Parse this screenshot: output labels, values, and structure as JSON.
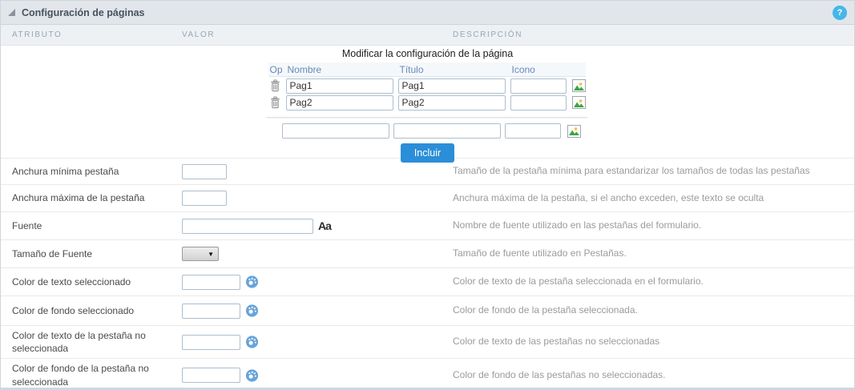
{
  "panel": {
    "title": "Configuración de páginas"
  },
  "help": {
    "label": "?"
  },
  "columns": {
    "attribute": "Atributo",
    "value": "Valor",
    "description": "Descripción"
  },
  "page_editor": {
    "title": "Modificar la configuración de la página",
    "headers": {
      "op": "Op",
      "name": "Nombre",
      "page_title": "Título",
      "icon": "Icono"
    },
    "rows": [
      {
        "name": "Pag1",
        "page_title": "Pag1",
        "icon": ""
      },
      {
        "name": "Pag2",
        "page_title": "Pag2",
        "icon": ""
      }
    ],
    "new_row": {
      "name": "",
      "page_title": "",
      "icon": ""
    },
    "include_button": "Incluir"
  },
  "attributes": [
    {
      "label": "Anchura mínima pestaña",
      "value": "",
      "description": "Tamaño de la pestaña mínima para estandarizar los tamaños de todas las pestañas"
    },
    {
      "label": "Anchura máxima de la pestaña",
      "value": "",
      "description": "Anchura máxima de la pestaña, si el ancho exceden, este texto se oculta"
    },
    {
      "label": "Fuente",
      "value": "",
      "description": "Nombre de fuente utilizado en las pestañas del formulario.",
      "icon_label": "Aa"
    },
    {
      "label": "Tamaño de Fuente",
      "value": "",
      "description": "Tamaño de fuente utilizado en Pestañas."
    },
    {
      "label": "Color de texto seleccionado",
      "value": "",
      "description": "Color de texto de la pestaña seleccionada en el formulario."
    },
    {
      "label": "Color de fondo seleccionado",
      "value": "",
      "description": "Color de fondo de la pestaña seleccionada."
    },
    {
      "label": "Color de texto de la pestaña no seleccionada",
      "value": "",
      "description": "Color de texto de las pestañas no seleccionadas"
    },
    {
      "label": "Color de fondo de la pestaña no seleccionada",
      "value": "",
      "description": "Color de fondo de las pestañas no seleccionadas."
    }
  ],
  "colors": {
    "accent_blue": "#2b8ed8",
    "help_blue": "#45b7e8",
    "header_bg": "#e2e6ea",
    "colhead_bg": "#edf1f4",
    "inner_header_text": "#6889b8",
    "palette_blue": "#68a4d9"
  }
}
